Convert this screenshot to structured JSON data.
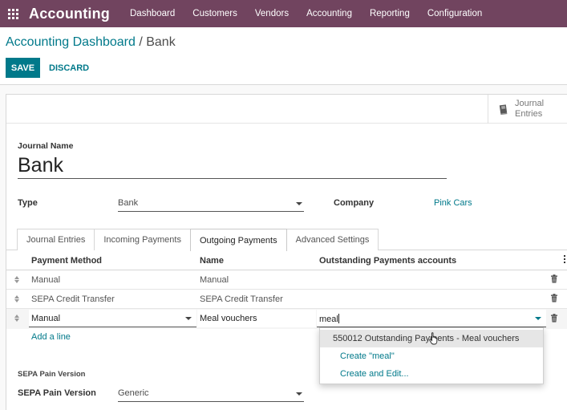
{
  "navbar": {
    "brand": "Accounting",
    "menu": [
      "Dashboard",
      "Customers",
      "Vendors",
      "Accounting",
      "Reporting",
      "Configuration"
    ]
  },
  "breadcrumb": {
    "parent": "Accounting Dashboard",
    "separator": " / ",
    "current": "Bank"
  },
  "toolbar": {
    "save_label": "SAVE",
    "discard_label": "DISCARD"
  },
  "smart_button": {
    "line1": "Journal",
    "line2": "Entries"
  },
  "form": {
    "journal_name_label": "Journal Name",
    "journal_name": "Bank",
    "type_label": "Type",
    "type_value": "Bank",
    "company_label": "Company",
    "company_value": "Pink Cars"
  },
  "tabs": [
    "Journal Entries",
    "Incoming Payments",
    "Outgoing Payments",
    "Advanced Settings"
  ],
  "active_tab": "Outgoing Payments",
  "table": {
    "headers": [
      "Payment Method",
      "Name",
      "Outstanding Payments accounts"
    ],
    "rows": [
      {
        "method": "Manual",
        "name": "Manual",
        "account": ""
      },
      {
        "method": "SEPA Credit Transfer",
        "name": "SEPA Credit Transfer",
        "account": ""
      }
    ],
    "editing": {
      "method": "Manual",
      "name": "Meal vouchers",
      "account_input": "meal"
    },
    "add_line": "Add a line"
  },
  "autocomplete": {
    "items": [
      "550012 Outstanding Payments - Meal vouchers",
      "Create \"meal\"",
      "Create and Edit..."
    ]
  },
  "sepa": {
    "section_label": "SEPA Pain Version",
    "field_label": "SEPA Pain Version",
    "value": "Generic"
  },
  "colors": {
    "navbar": "#71445f",
    "accent": "#00798a"
  }
}
